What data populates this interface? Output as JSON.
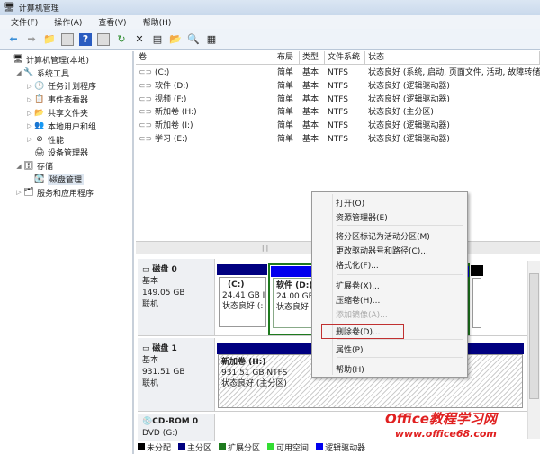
{
  "title": "计算机管理",
  "menu": [
    "文件(F)",
    "操作(A)",
    "查看(V)",
    "帮助(H)"
  ],
  "tree": [
    {
      "label": "计算机管理(本地)",
      "level": 0,
      "exp": ""
    },
    {
      "label": "系统工具",
      "level": 1,
      "exp": "◢"
    },
    {
      "label": "任务计划程序",
      "level": 2,
      "exp": "▷"
    },
    {
      "label": "事件查看器",
      "level": 2,
      "exp": "▷"
    },
    {
      "label": "共享文件夹",
      "level": 2,
      "exp": "▷"
    },
    {
      "label": "本地用户和组",
      "level": 2,
      "exp": "▷"
    },
    {
      "label": "性能",
      "level": 2,
      "exp": "▷"
    },
    {
      "label": "设备管理器",
      "level": 2,
      "exp": ""
    },
    {
      "label": "存储",
      "level": 1,
      "exp": "◢"
    },
    {
      "label": "磁盘管理",
      "level": 2,
      "exp": "",
      "selected": true
    },
    {
      "label": "服务和应用程序",
      "level": 1,
      "exp": "▷"
    }
  ],
  "columns": [
    "卷",
    "布局",
    "类型",
    "文件系统",
    "状态"
  ],
  "volumes": [
    [
      "(C:)",
      "简单",
      "基本",
      "NTFS",
      "状态良好 (系统, 启动, 页面文件, 活动, 故障转储"
    ],
    [
      "软件 (D:)",
      "简单",
      "基本",
      "NTFS",
      "状态良好 (逻辑驱动器)"
    ],
    [
      "视频 (F:)",
      "简单",
      "基本",
      "NTFS",
      "状态良好 (逻辑驱动器)"
    ],
    [
      "新加卷 (H:)",
      "简单",
      "基本",
      "NTFS",
      "状态良好 (主分区)"
    ],
    [
      "新加卷 (I:)",
      "简单",
      "基本",
      "NTFS",
      "状态良好 (逻辑驱动器)"
    ],
    [
      "学习 (E:)",
      "简单",
      "基本",
      "NTFS",
      "状态良好 (逻辑驱动器)"
    ]
  ],
  "disk0": {
    "name": "磁盘 0",
    "type": "基本",
    "size": "149.05 GB",
    "status": "联机",
    "c": {
      "name": "(C:)",
      "size": "24.41 GB I",
      "status": "状态良好 (:"
    },
    "d": {
      "name": "软件  (D:)",
      "size": "24.00 GB",
      "status": "状态良好 ("
    }
  },
  "disk1": {
    "name": "磁盘 1",
    "type": "基本",
    "size": "931.51 GB",
    "status": "联机",
    "h": {
      "name": "新加卷  (H:)",
      "size": "931.51 GB NTFS",
      "status": "状态良好 (主分区)"
    }
  },
  "cdrom": {
    "name": "CD-ROM 0",
    "drive": "DVD (G:)"
  },
  "legend": [
    {
      "label": "未分配",
      "color": "#000000"
    },
    {
      "label": "主分区",
      "color": "#000080"
    },
    {
      "label": "扩展分区",
      "color": "#1e7a1e"
    },
    {
      "label": "可用空间",
      "color": "#33dd33"
    },
    {
      "label": "逻辑驱动器",
      "color": "#0000ee"
    }
  ],
  "context_menu": [
    "打开(O)",
    "资源管理器(E)",
    "将分区标记为活动分区(M)",
    "更改驱动器号和路径(C)...",
    "格式化(F)...",
    "扩展卷(X)...",
    "压缩卷(H)...",
    "添加镜像(A)...",
    "删除卷(D)...",
    "属性(P)",
    "帮助(H)"
  ],
  "watermark": {
    "line1": "Office教程学习网",
    "line2": "www.office68.com"
  }
}
